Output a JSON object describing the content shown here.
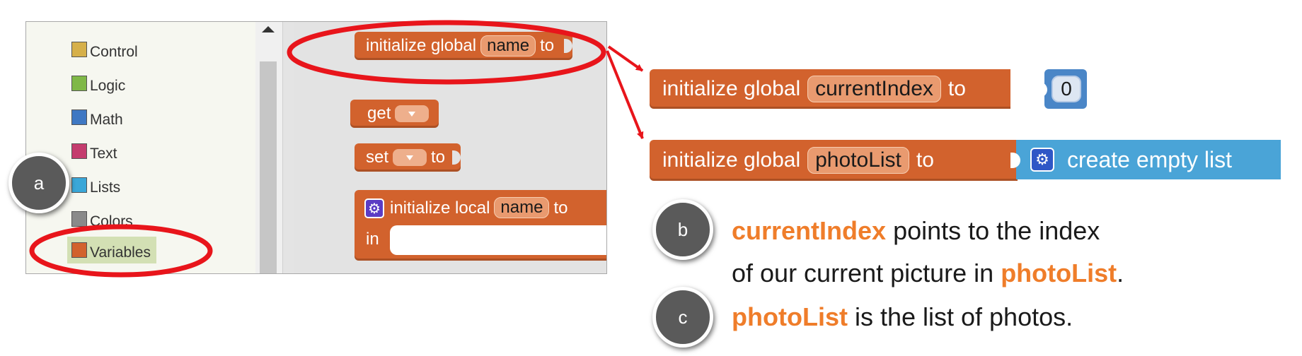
{
  "drawer": {
    "categories": [
      {
        "label": "Control",
        "color": "#d6b04a"
      },
      {
        "label": "Logic",
        "color": "#7fb847"
      },
      {
        "label": "Math",
        "color": "#3f78c3"
      },
      {
        "label": "Text",
        "color": "#c43c6e"
      },
      {
        "label": "Lists",
        "color": "#3aa7d8"
      },
      {
        "label": "Colors",
        "color": "#8a8a8a"
      },
      {
        "label": "Variables",
        "color": "#d2622d"
      }
    ]
  },
  "flyout": {
    "init_global": {
      "prefix": "initialize global",
      "field": "name",
      "suffix": "to"
    },
    "get": {
      "label": "get"
    },
    "set": {
      "label": "set",
      "suffix": "to"
    },
    "init_local": {
      "prefix": "initialize local",
      "field": "name",
      "suffix": "to",
      "in_label": "in"
    }
  },
  "blocks": {
    "current_index": {
      "prefix": "initialize global",
      "field": "currentIndex",
      "suffix": "to",
      "value": "0"
    },
    "photo_list": {
      "prefix": "initialize global",
      "field": "photoList",
      "suffix": "to",
      "list_label": "create empty list"
    }
  },
  "badges": {
    "a": "a",
    "b": "b",
    "c": "c"
  },
  "notes": {
    "b_line1_hl": "currentIndex",
    "b_line1_rest": " points to the index",
    "b_line2_pre": "of our current picture in ",
    "b_line2_hl": "photoList",
    "b_line2_post": ".",
    "c_hl": "photoList",
    "c_rest": " is the list of photos."
  },
  "colors": {
    "accent_red": "#e8151b",
    "variable_block": "#d2622d",
    "highlight_orange": "#ef7d2a"
  }
}
